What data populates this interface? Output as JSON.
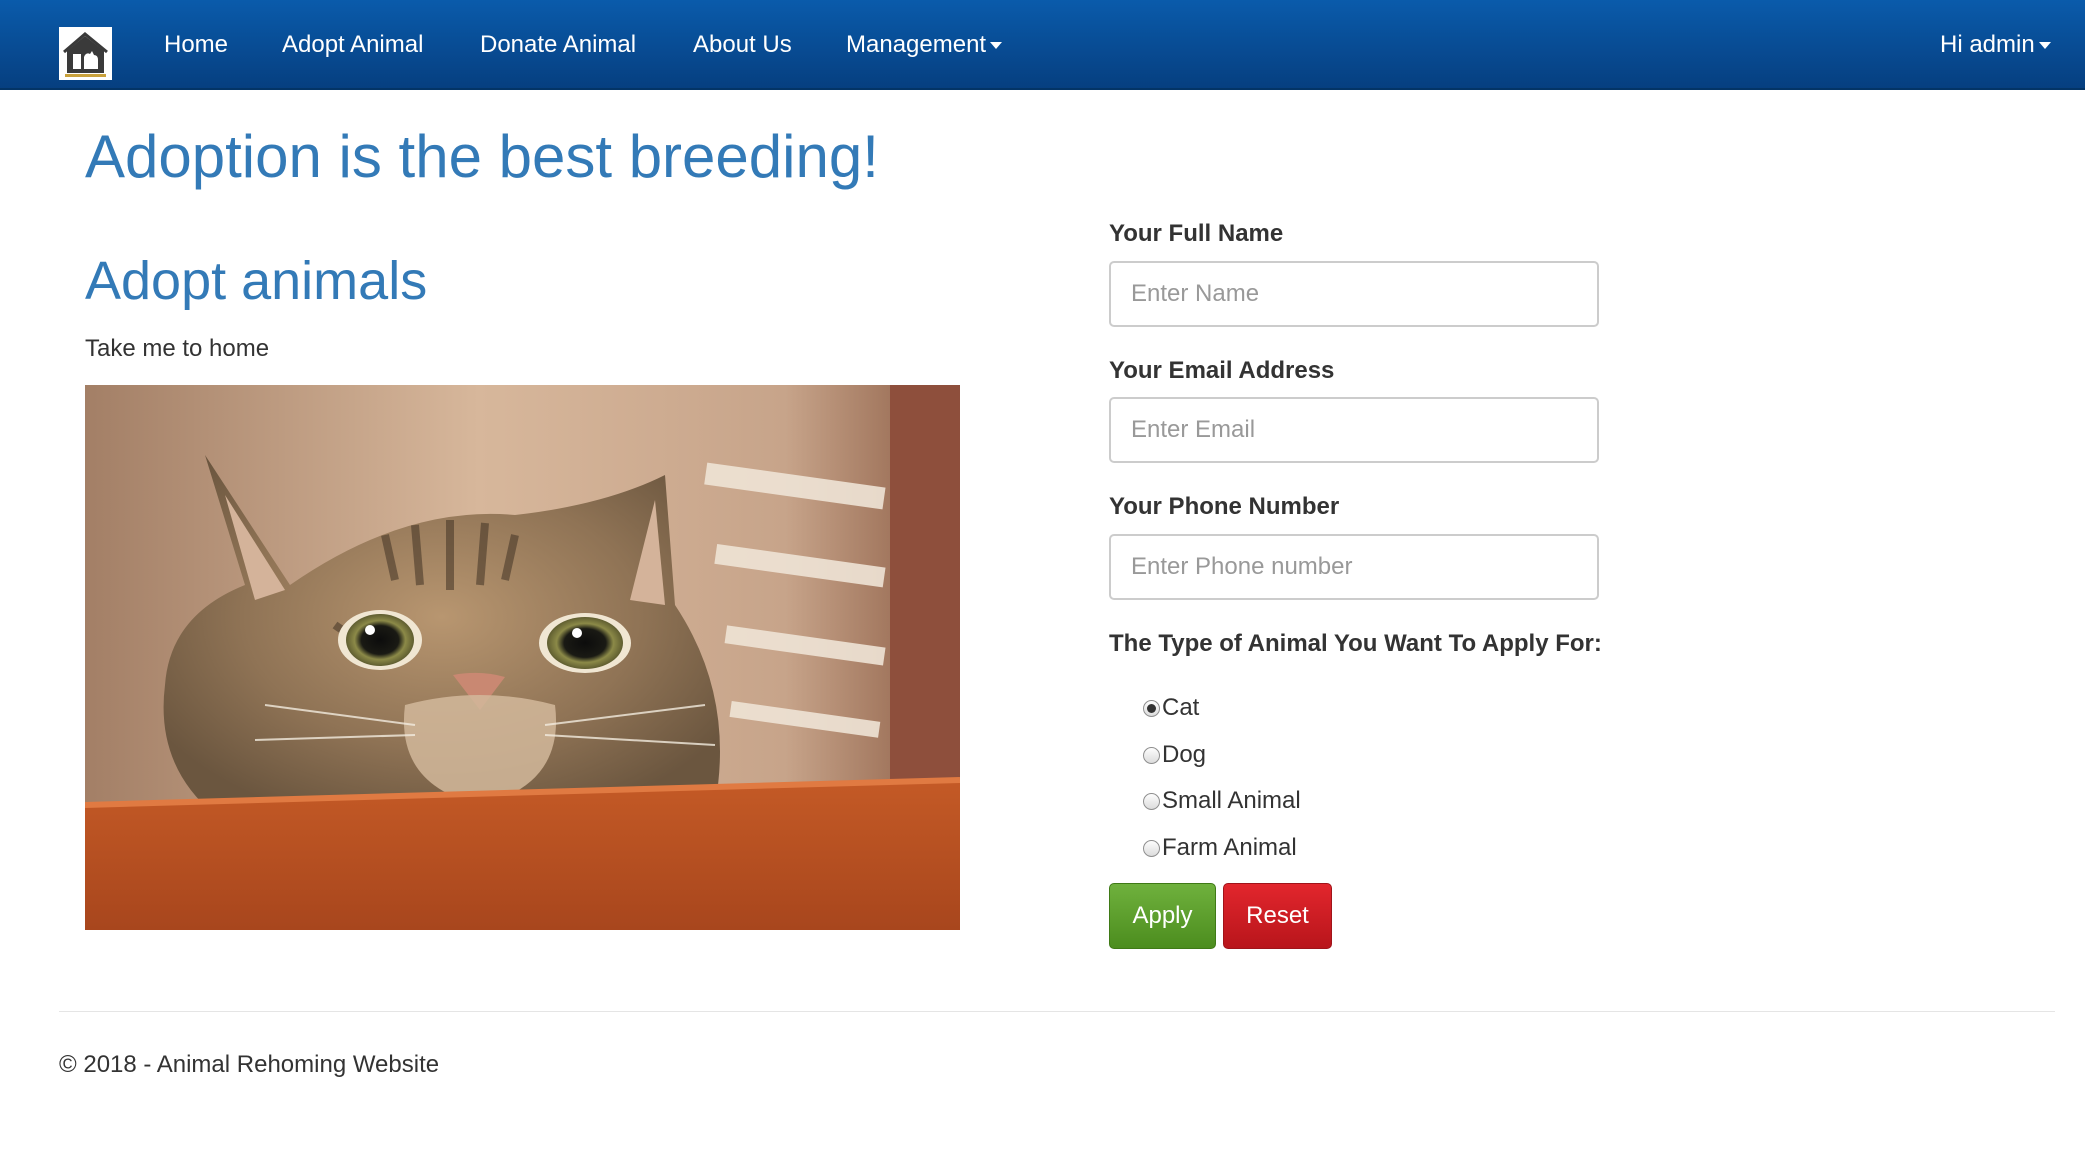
{
  "navbar": {
    "logo_icon": "house-with-animals-logo",
    "items": [
      {
        "label": "Home"
      },
      {
        "label": "Adopt Animal"
      },
      {
        "label": "Donate Animal"
      },
      {
        "label": "About Us"
      },
      {
        "label": "Management"
      }
    ],
    "user_menu_label": "Hi admin",
    "colors": {
      "bar": "#0a5bab",
      "text": "#ffffff"
    }
  },
  "main": {
    "headline": "Adoption is the best breeding!",
    "subheadline": "Adopt animals",
    "tagline": "Take me to home",
    "image_subject": "tabby cat peeking over wooden table"
  },
  "form": {
    "name_label": "Your Full Name",
    "name_placeholder": "Enter Name",
    "name_value": "",
    "email_label": "Your Email Address",
    "email_placeholder": "Enter Email",
    "email_value": "",
    "phone_label": "Your Phone Number",
    "phone_placeholder": "Enter Phone number",
    "phone_value": "",
    "animal_type_label": "The Type of Animal You Want To Apply For:",
    "animal_options": [
      {
        "label": "Cat",
        "checked": true
      },
      {
        "label": "Dog",
        "checked": false
      },
      {
        "label": "Small Animal",
        "checked": false
      },
      {
        "label": "Farm Animal",
        "checked": false
      }
    ],
    "apply_label": "Apply",
    "reset_label": "Reset",
    "colors": {
      "apply": "#5cb85c",
      "reset": "#d9232a",
      "heading": "#337ab7"
    }
  },
  "footer": {
    "text": "© 2018 - Animal Rehoming Website"
  }
}
